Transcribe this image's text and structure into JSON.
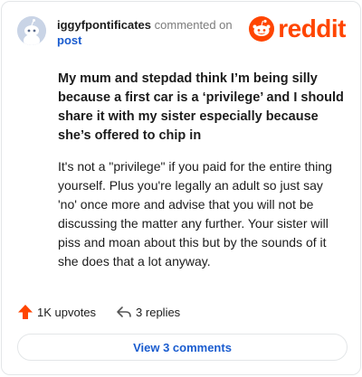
{
  "comment": {
    "username": "iggyfpontificates",
    "action_text": "commented on",
    "post_link": "post",
    "title": "My mum and stepdad think I’m being silly because a first car is a ‘privilege’ and I should share it with my sister especially because she’s offered to chip in",
    "body": "It's not a \"privilege\" if you paid for the entire thing yourself. Plus you're legally an adult so just say 'no' once more and advise that you will not be discussing the matter any further. Your sister will piss and moan about this but by the sounds of it she does that a lot anyway."
  },
  "brand": {
    "wordmark": "reddit",
    "color": "#ff4500"
  },
  "actions": {
    "upvotes_label": "1K upvotes",
    "replies_label": "3 replies",
    "view_comments_label": "View 3 comments"
  },
  "icons": {
    "avatar": "snoo-avatar-icon",
    "logo": "reddit-snoo-icon",
    "upvote": "upvote-arrow-icon",
    "reply": "reply-arrow-icon"
  },
  "colors": {
    "link": "#1a5ccf",
    "upvote": "#ff4500",
    "muted": "#7c7c7c"
  }
}
